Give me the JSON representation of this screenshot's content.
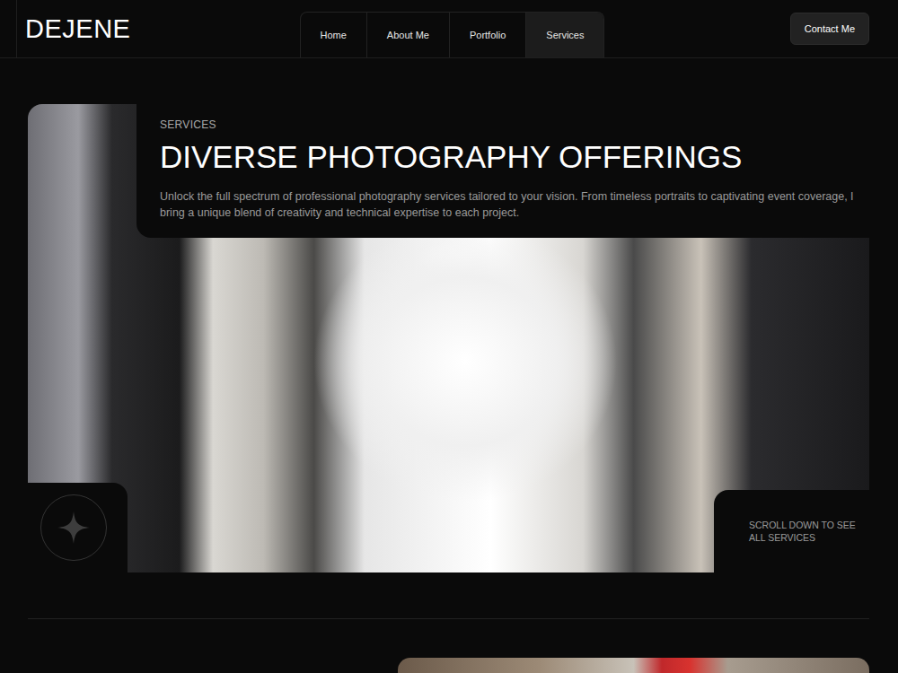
{
  "header": {
    "logo": "DEJENE",
    "nav": [
      {
        "label": "Home",
        "selected": false
      },
      {
        "label": "About Me",
        "selected": false
      },
      {
        "label": "Portfolio",
        "selected": false
      },
      {
        "label": "Services",
        "selected": true
      }
    ],
    "contact_button": "Contact Me"
  },
  "hero": {
    "eyebrow": "SERVICES",
    "title": "DIVERSE PHOTOGRAPHY OFFERINGS",
    "description": "Unlock the full spectrum of professional photography services tailored to your vision. From timeless portraits to captivating event coverage, I bring a unique blend of creativity and technical expertise to each project.",
    "scroll_hint": "SCROLL DOWN TO SEE ALL SERVICES"
  }
}
